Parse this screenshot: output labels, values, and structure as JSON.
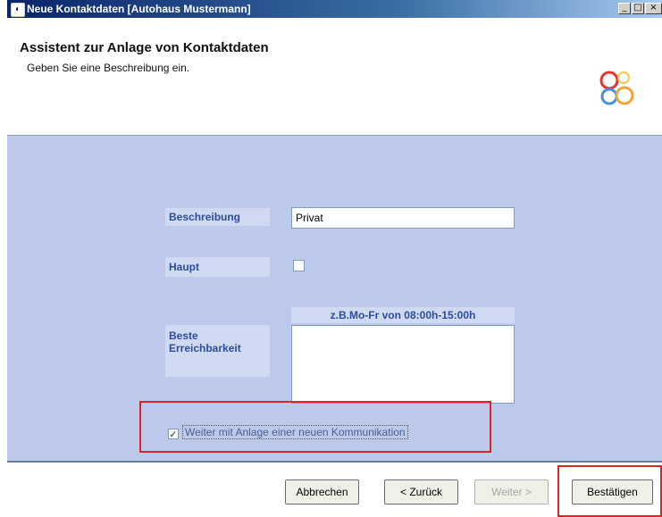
{
  "window": {
    "title": "Neue Kontaktdaten [Autohaus Mustermann]",
    "app_icon": "contact-app-icon",
    "controls": {
      "minimize": "_",
      "maximize": "□",
      "close": "×"
    }
  },
  "header": {
    "title": "Assistent zur Anlage von Kontaktdaten",
    "subtitle": "Geben Sie eine Beschreibung ein.",
    "logo": "colored-rings-logo",
    "logo_colors": [
      "#e3342f",
      "#f2c94c",
      "#4a90d9",
      "#f2a33a"
    ]
  },
  "form": {
    "description_label": "Beschreibung",
    "description_value": "Privat",
    "main_label": "Haupt",
    "main_checked": false,
    "reachability_label": "Beste Erreichbarkeit",
    "reachability_hint": "z.B.Mo-Fr von 08:00h-15:00h",
    "reachability_value": ""
  },
  "continue_option": {
    "checked": true,
    "check_glyph": "✓",
    "label": "Weiter mit Anlage einer neuen Kommunikation"
  },
  "buttons": {
    "cancel": "Abbrechen",
    "back": "< Zurück",
    "next": "Weiter >",
    "confirm": "Bestätigen"
  },
  "colors": {
    "content_bg": "#bcc9ea",
    "label_text": "#2b4d9b",
    "highlight_red": "#e02424",
    "titlebar": "#0a246a"
  }
}
